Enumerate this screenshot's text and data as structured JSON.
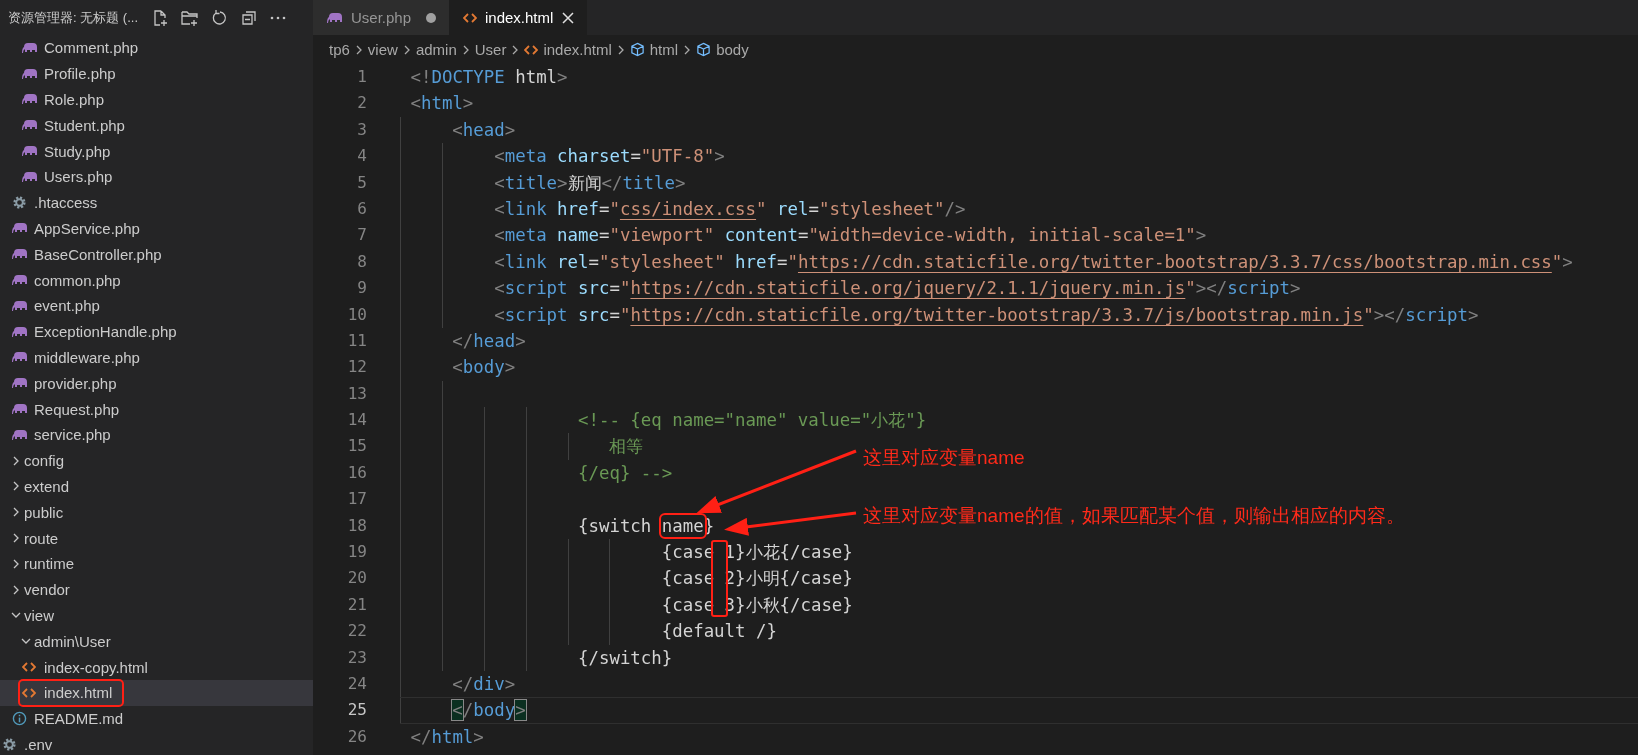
{
  "explorer": {
    "title": "资源管理器: 无标题 (...",
    "tree": [
      {
        "children": [
          {
            "children": [
              {
                "label": "Comment.php",
                "kind": "php",
                "selected": false,
                "boxed": false
              },
              {
                "label": "Profile.php",
                "kind": "php",
                "selected": false,
                "boxed": false
              },
              {
                "label": "Role.php",
                "kind": "php",
                "selected": false,
                "boxed": false
              },
              {
                "label": "Student.php",
                "kind": "php",
                "selected": false,
                "boxed": false
              },
              {
                "label": "Study.php",
                "kind": "php",
                "selected": false,
                "boxed": false
              },
              {
                "label": "Users.php",
                "kind": "php",
                "selected": false,
                "boxed": false
              }
            ]
          },
          {
            "label": ".htaccess",
            "kind": "gear",
            "selected": false,
            "boxed": false
          },
          {
            "label": "AppService.php",
            "kind": "php",
            "selected": false,
            "boxed": false
          },
          {
            "label": "BaseController.php",
            "kind": "php",
            "selected": false,
            "boxed": false
          },
          {
            "label": "common.php",
            "kind": "php",
            "selected": false,
            "boxed": false
          },
          {
            "label": "event.php",
            "kind": "php",
            "selected": false,
            "boxed": false
          },
          {
            "label": "ExceptionHandle.php",
            "kind": "php",
            "selected": false,
            "boxed": false
          },
          {
            "label": "middleware.php",
            "kind": "php",
            "selected": false,
            "boxed": false
          },
          {
            "label": "provider.php",
            "kind": "php",
            "selected": false,
            "boxed": false
          },
          {
            "label": "Request.php",
            "kind": "php",
            "selected": false,
            "boxed": false
          },
          {
            "label": "service.php",
            "kind": "php",
            "selected": false,
            "boxed": false
          }
        ]
      },
      {
        "label": "config",
        "kind": "folder",
        "expanded": false,
        "selected": false,
        "boxed": false
      },
      {
        "label": "extend",
        "kind": "folder",
        "expanded": false,
        "selected": false,
        "boxed": false
      },
      {
        "label": "public",
        "kind": "folder",
        "expanded": false,
        "selected": false,
        "boxed": false
      },
      {
        "label": "route",
        "kind": "folder",
        "expanded": false,
        "selected": false,
        "boxed": false
      },
      {
        "label": "runtime",
        "kind": "folder",
        "expanded": false,
        "selected": false,
        "boxed": false
      },
      {
        "label": "vendor",
        "kind": "folder",
        "expanded": false,
        "selected": false,
        "boxed": false
      },
      {
        "label": "view",
        "kind": "folder",
        "expanded": true,
        "selected": false,
        "boxed": false,
        "children": [
          {
            "label": "admin\\User",
            "kind": "folder",
            "expanded": true,
            "selected": false,
            "boxed": false,
            "children": [
              {
                "label": "index-copy.html",
                "kind": "html",
                "selected": false,
                "boxed": false
              },
              {
                "label": "index.html",
                "kind": "html",
                "selected": true,
                "boxed": true
              }
            ]
          },
          {
            "label": "README.md",
            "kind": "info",
            "selected": false,
            "boxed": false
          }
        ]
      },
      {
        "label": ".env",
        "kind": "gear",
        "selected": false,
        "boxed": false
      }
    ]
  },
  "tabs": [
    {
      "label": "User.php",
      "kind": "php",
      "selected": false,
      "modified": true
    },
    {
      "label": "index.html",
      "kind": "html",
      "selected": true,
      "modified": false
    }
  ],
  "breadcrumb": [
    {
      "label": "tp6",
      "kind": "folder"
    },
    {
      "label": "view",
      "kind": "folder"
    },
    {
      "label": "admin",
      "kind": "folder"
    },
    {
      "label": "User",
      "kind": "folder"
    },
    {
      "label": "index.html",
      "kind": "html"
    },
    {
      "label": "html",
      "kind": "element"
    },
    {
      "label": "body",
      "kind": "element"
    }
  ],
  "code": [
    {
      "n": "1",
      "current": false,
      "tokens": [
        {
          "kind": "punct",
          "t": "<!"
        },
        {
          "kind": "tag",
          "t": "DOCTYPE"
        },
        {
          "kind": "text",
          "t": " html"
        },
        {
          "kind": "punct",
          "t": ">"
        }
      ]
    },
    {
      "n": "2",
      "current": false,
      "tokens": [
        {
          "kind": "punct",
          "t": "<"
        },
        {
          "kind": "tag",
          "t": "html"
        },
        {
          "kind": "punct",
          "t": ">"
        }
      ]
    },
    {
      "n": "3",
      "current": false,
      "tokens": [
        {
          "kind": "punct",
          "t": "    <"
        },
        {
          "kind": "tag",
          "t": "head"
        },
        {
          "kind": "punct",
          "t": ">"
        }
      ]
    },
    {
      "n": "4",
      "current": false,
      "tokens": [
        {
          "kind": "punct",
          "t": "        <"
        },
        {
          "kind": "tag",
          "t": "meta"
        },
        {
          "kind": "attr",
          "t": " charset"
        },
        {
          "kind": "text",
          "t": "="
        },
        {
          "kind": "string",
          "t": "\"UTF-8\""
        },
        {
          "kind": "punct",
          "t": ">"
        }
      ]
    },
    {
      "n": "5",
      "current": false,
      "tokens": [
        {
          "kind": "punct",
          "t": "        <"
        },
        {
          "kind": "tag",
          "t": "title"
        },
        {
          "kind": "punct",
          "t": ">"
        },
        {
          "kind": "text",
          "t": "新闻"
        },
        {
          "kind": "punct",
          "t": "</"
        },
        {
          "kind": "tag",
          "t": "title"
        },
        {
          "kind": "punct",
          "t": ">"
        }
      ]
    },
    {
      "n": "6",
      "current": false,
      "tokens": [
        {
          "kind": "punct",
          "t": "        <"
        },
        {
          "kind": "tag",
          "t": "link"
        },
        {
          "kind": "attr",
          "t": " href"
        },
        {
          "kind": "text",
          "t": "="
        },
        {
          "kind": "string",
          "t": "\""
        },
        {
          "kind": "link",
          "t": "css/index.css"
        },
        {
          "kind": "string",
          "t": "\""
        },
        {
          "kind": "attr",
          "t": " rel"
        },
        {
          "kind": "text",
          "t": "="
        },
        {
          "kind": "string",
          "t": "\"stylesheet\""
        },
        {
          "kind": "punct",
          "t": "/>"
        }
      ]
    },
    {
      "n": "7",
      "current": false,
      "tokens": [
        {
          "kind": "punct",
          "t": "        <"
        },
        {
          "kind": "tag",
          "t": "meta"
        },
        {
          "kind": "attr",
          "t": " name"
        },
        {
          "kind": "text",
          "t": "="
        },
        {
          "kind": "string",
          "t": "\"viewport\""
        },
        {
          "kind": "attr",
          "t": " content"
        },
        {
          "kind": "text",
          "t": "="
        },
        {
          "kind": "string",
          "t": "\"width=device-width, initial-scale=1\""
        },
        {
          "kind": "punct",
          "t": ">"
        }
      ]
    },
    {
      "n": "8",
      "current": false,
      "tokens": [
        {
          "kind": "punct",
          "t": "        <"
        },
        {
          "kind": "tag",
          "t": "link"
        },
        {
          "kind": "attr",
          "t": " rel"
        },
        {
          "kind": "text",
          "t": "="
        },
        {
          "kind": "string",
          "t": "\"stylesheet\""
        },
        {
          "kind": "attr",
          "t": " href"
        },
        {
          "kind": "text",
          "t": "="
        },
        {
          "kind": "string",
          "t": "\""
        },
        {
          "kind": "link",
          "t": "https://cdn.staticfile.org/twitter-bootstrap/3.3.7/css/bootstrap.min.css"
        },
        {
          "kind": "string",
          "t": "\""
        },
        {
          "kind": "punct",
          "t": ">"
        }
      ]
    },
    {
      "n": "9",
      "current": false,
      "tokens": [
        {
          "kind": "punct",
          "t": "        <"
        },
        {
          "kind": "tag",
          "t": "script"
        },
        {
          "kind": "attr",
          "t": " src"
        },
        {
          "kind": "text",
          "t": "="
        },
        {
          "kind": "string",
          "t": "\""
        },
        {
          "kind": "link",
          "t": "https://cdn.staticfile.org/jquery/2.1.1/jquery.min.js"
        },
        {
          "kind": "string",
          "t": "\""
        },
        {
          "kind": "punct",
          "t": "></"
        },
        {
          "kind": "tag",
          "t": "script"
        },
        {
          "kind": "punct",
          "t": ">"
        }
      ]
    },
    {
      "n": "10",
      "current": false,
      "tokens": [
        {
          "kind": "punct",
          "t": "        <"
        },
        {
          "kind": "tag",
          "t": "script"
        },
        {
          "kind": "attr",
          "t": " src"
        },
        {
          "kind": "text",
          "t": "="
        },
        {
          "kind": "string",
          "t": "\""
        },
        {
          "kind": "link",
          "t": "https://cdn.staticfile.org/twitter-bootstrap/3.3.7/js/bootstrap.min.js"
        },
        {
          "kind": "string",
          "t": "\""
        },
        {
          "kind": "punct",
          "t": "></"
        },
        {
          "kind": "tag",
          "t": "script"
        },
        {
          "kind": "punct",
          "t": ">"
        }
      ]
    },
    {
      "n": "11",
      "current": false,
      "tokens": [
        {
          "kind": "punct",
          "t": "    </"
        },
        {
          "kind": "tag",
          "t": "head"
        },
        {
          "kind": "punct",
          "t": ">"
        }
      ]
    },
    {
      "n": "12",
      "current": false,
      "tokens": [
        {
          "kind": "punct",
          "t": "    <"
        },
        {
          "kind": "tag",
          "t": "body"
        },
        {
          "kind": "punct",
          "t": ">"
        }
      ]
    },
    {
      "n": "13",
      "current": false
    },
    {
      "n": "14",
      "current": false,
      "tokens": [
        {
          "kind": "comment",
          "t": "                <!-- {eq name=\"name\" value=\"小花\"}"
        }
      ]
    },
    {
      "n": "15",
      "current": false,
      "tokens": [
        {
          "kind": "comment",
          "t": "                   相等"
        }
      ]
    },
    {
      "n": "16",
      "current": false,
      "tokens": [
        {
          "kind": "comment",
          "t": "                {/eq} -->"
        }
      ]
    },
    {
      "n": "17",
      "current": false
    },
    {
      "n": "18",
      "current": false,
      "tokens": [
        {
          "kind": "text",
          "t": "                {switch "
        },
        {
          "kind": "boxed",
          "t": "name"
        },
        {
          "kind": "text",
          "t": "}"
        }
      ]
    },
    {
      "n": "19",
      "current": false,
      "tokens": [
        {
          "kind": "text",
          "t": "                        {case 1}小花{/case}"
        }
      ]
    },
    {
      "n": "20",
      "current": false,
      "tokens": [
        {
          "kind": "text",
          "t": "                        {case 2}小明{/case}"
        }
      ]
    },
    {
      "n": "21",
      "current": false,
      "tokens": [
        {
          "kind": "text",
          "t": "                        {case 3}小秋{/case}"
        }
      ]
    },
    {
      "n": "22",
      "current": false,
      "tokens": [
        {
          "kind": "text",
          "t": "                        {default /}"
        }
      ]
    },
    {
      "n": "23",
      "current": false,
      "tokens": [
        {
          "kind": "text",
          "t": "                {/switch}"
        }
      ]
    },
    {
      "n": "24",
      "current": false,
      "tokens": [
        {
          "kind": "punct",
          "t": "    </"
        },
        {
          "kind": "tag",
          "t": "div"
        },
        {
          "kind": "punct",
          "t": ">"
        }
      ]
    },
    {
      "n": "25",
      "current": true,
      "tokens": [
        {
          "kind": "matched",
          "t": "    <"
        },
        {
          "kind": "punct",
          "t": "/"
        },
        {
          "kind": "tag",
          "t": "body"
        },
        {
          "kind": "matched",
          "t": ">"
        }
      ]
    },
    {
      "n": "26",
      "current": false,
      "tokens": [
        {
          "kind": "punct",
          "t": "</"
        },
        {
          "kind": "tag",
          "t": "html"
        },
        {
          "kind": "punct",
          "t": ">"
        }
      ]
    }
  ],
  "annotations": [
    {
      "text": "这里对应变量name"
    },
    {
      "text": "这里对应变量name的值，如果匹配某个值，则输出相应的内容。"
    }
  ]
}
